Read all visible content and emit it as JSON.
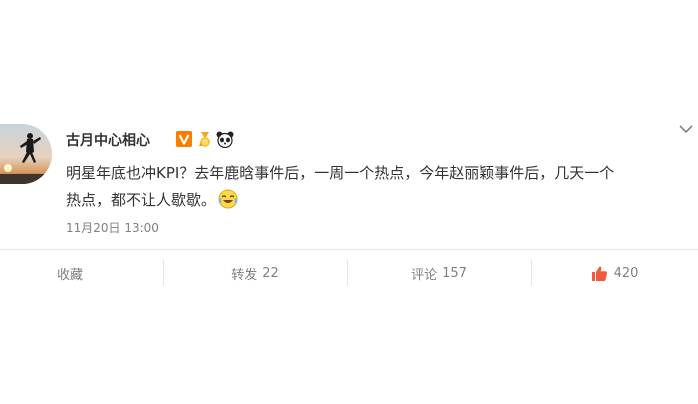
{
  "post": {
    "username": "古月中心相心",
    "badges": [
      "verified-v-icon",
      "gold-medal-icon",
      "panda-icon"
    ],
    "content_line1": "明星年底也冲KPI？去年鹿晗事件后，一周一个热点，今年赵丽颖事件后，几天一个",
    "content_line2": "热点，都不让人歇歇。",
    "emoji": "laugh-cry-emoji-icon",
    "time": "11月20日 13:00"
  },
  "actions": {
    "favorite_label": "收藏",
    "repost_label": "转发",
    "repost_count": "22",
    "comment_label": "评论",
    "comment_count": "157",
    "like_count": "420"
  },
  "colors": {
    "text": "#333333",
    "muted": "#808080",
    "verified": "#f77e00",
    "like": "#f05a3c",
    "divider": "#e6e6e6"
  }
}
